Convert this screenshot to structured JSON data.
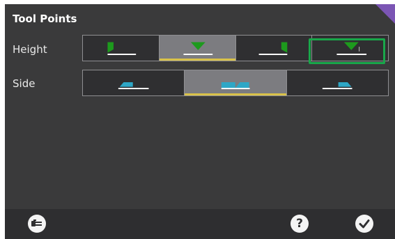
{
  "title": "Tool Points",
  "rows": {
    "height": {
      "label": "Height",
      "selected_index": 1
    },
    "side": {
      "label": "Side",
      "selected_index": 1
    }
  },
  "icons": {
    "height_options": [
      "height-top-left-icon",
      "height-top-center-icon",
      "height-top-right-icon",
      "height-top-center-alt-icon"
    ],
    "side_options": [
      "side-left-icon",
      "side-center-icon",
      "side-right-icon"
    ],
    "bottom_left": "tool-library-icon",
    "help": "help-icon",
    "confirm": "checkmark-icon"
  },
  "colors": {
    "accent_green": "#1d9a1d",
    "accent_cyan": "#2ea7c6",
    "selection_underline": "#d9c24a",
    "focus_highlight": "#19a74a",
    "corner": "#7b55b4"
  }
}
